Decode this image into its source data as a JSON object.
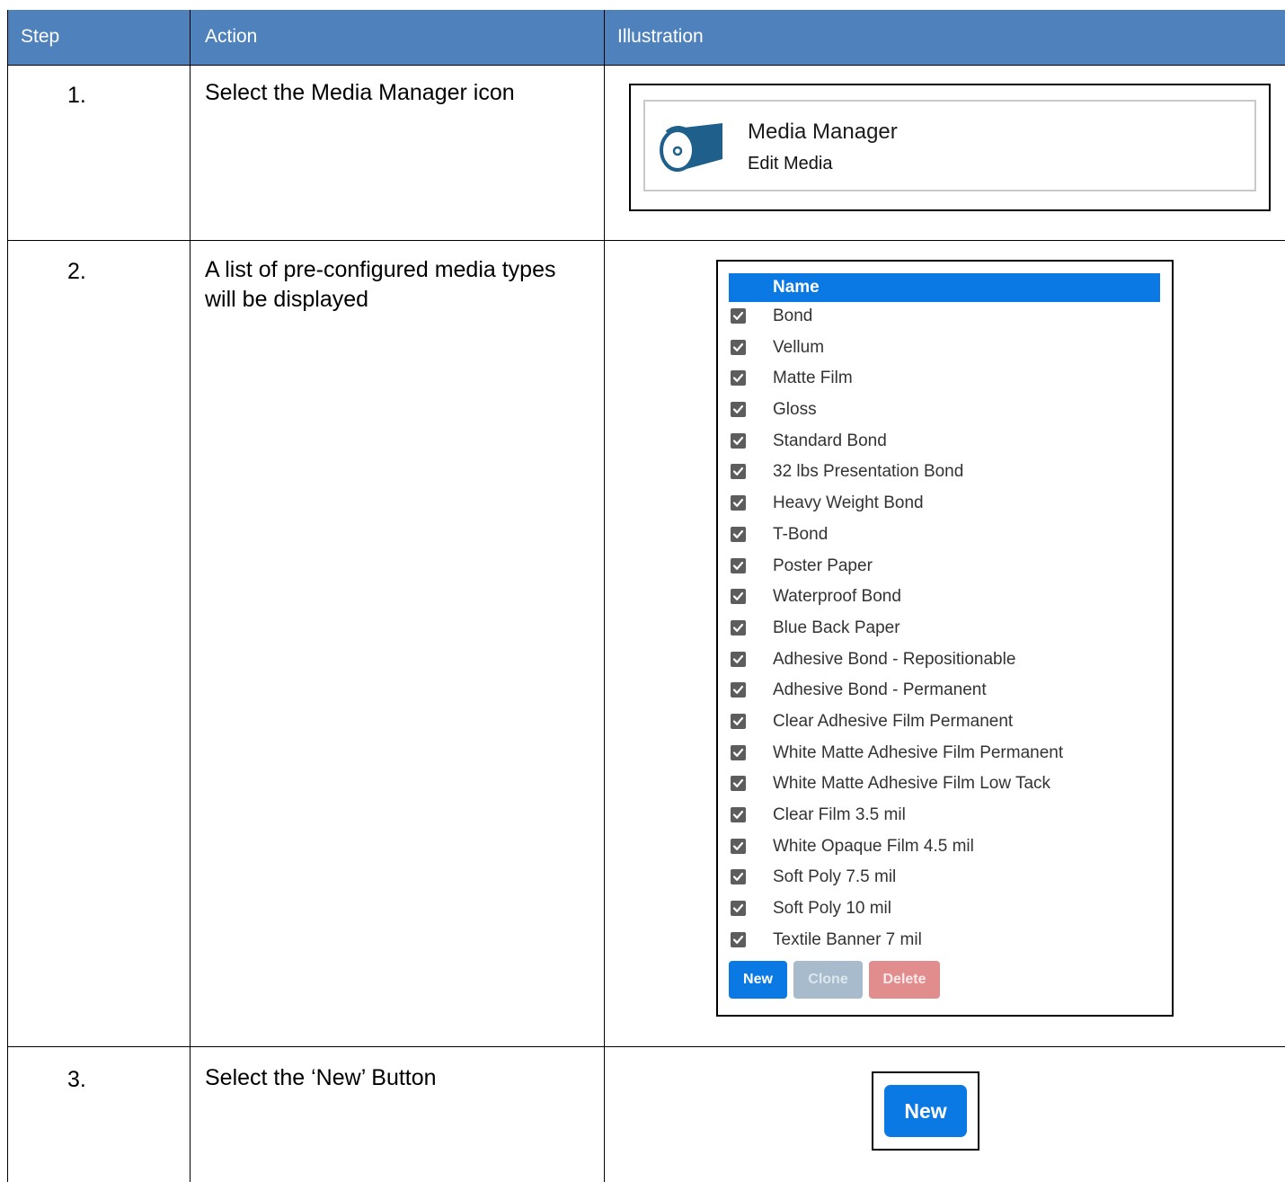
{
  "header": {
    "step": "Step",
    "action": "Action",
    "illustration": "Illustration"
  },
  "rows": [
    {
      "step": "1.",
      "action": "Select the Media Manager icon"
    },
    {
      "step": "2.",
      "action": "A list of pre-configured media types will be displayed"
    },
    {
      "step": "3.",
      "action": "Select the ‘New’ Button"
    }
  ],
  "media_manager": {
    "title": "Media Manager",
    "subtitle": "Edit Media",
    "icon": "media-roll-icon"
  },
  "media_list": {
    "column_header": "Name",
    "items": [
      "Bond",
      "Vellum",
      "Matte Film",
      "Gloss",
      "Standard Bond",
      "32 lbs Presentation Bond",
      "Heavy Weight Bond",
      "T-Bond",
      "Poster Paper",
      "Waterproof Bond",
      "Blue Back Paper",
      "Adhesive Bond - Repositionable",
      "Adhesive Bond - Permanent",
      "Clear Adhesive Film Permanent",
      "White Matte Adhesive Film Permanent",
      "White Matte Adhesive Film Low Tack",
      "Clear Film 3.5 mil",
      "White Opaque Film 4.5 mil",
      "Soft Poly 7.5 mil",
      "Soft Poly 10 mil",
      "Textile Banner 7 mil"
    ],
    "buttons": {
      "new": "New",
      "clone": "Clone",
      "delete": "Delete"
    }
  },
  "new_button": {
    "label": "New"
  },
  "colors": {
    "header_bg": "#4f81bd",
    "primary": "#0b79e3",
    "disabled": "#a7bbcd",
    "danger": "#e28d8d"
  }
}
